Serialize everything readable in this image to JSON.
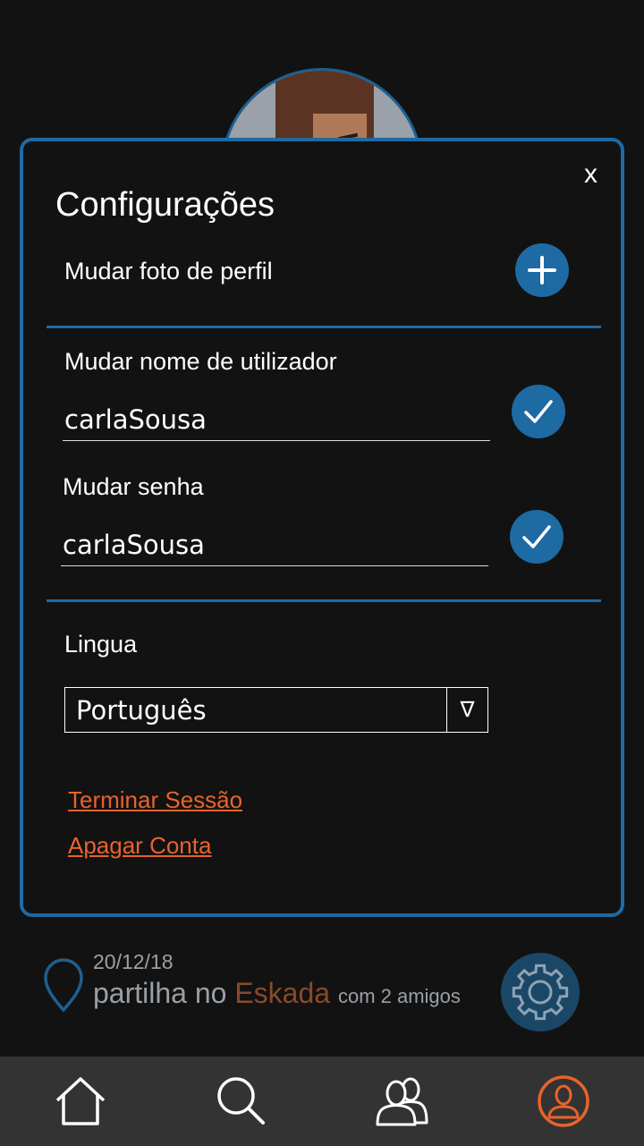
{
  "settings": {
    "close_label": "x",
    "title": "Configurações",
    "change_photo_label": "Mudar foto de perfil",
    "change_username_label": "Mudar nome de utilizador",
    "username_value": "carlaSousa",
    "change_password_label": "Mudar senha",
    "password_value": "carlaSousa",
    "language_label": "Lingua",
    "language_selected": "Português",
    "dropdown_arrow": "∇",
    "logout_label": "Terminar Sessão",
    "delete_account_label": "Apagar Conta"
  },
  "activity": {
    "date": "20/12/18",
    "text_prefix": "partilha no ",
    "place": "Eskada",
    "friends": "com 2 amigos"
  },
  "nav": {
    "items": [
      {
        "icon": "home-icon"
      },
      {
        "icon": "search-icon"
      },
      {
        "icon": "friends-icon"
      },
      {
        "icon": "profile-icon",
        "active": true
      }
    ]
  },
  "colors": {
    "accent_blue": "#1e6aa3",
    "accent_orange": "#e8632c",
    "background": "#121212",
    "navbar": "#333333"
  }
}
